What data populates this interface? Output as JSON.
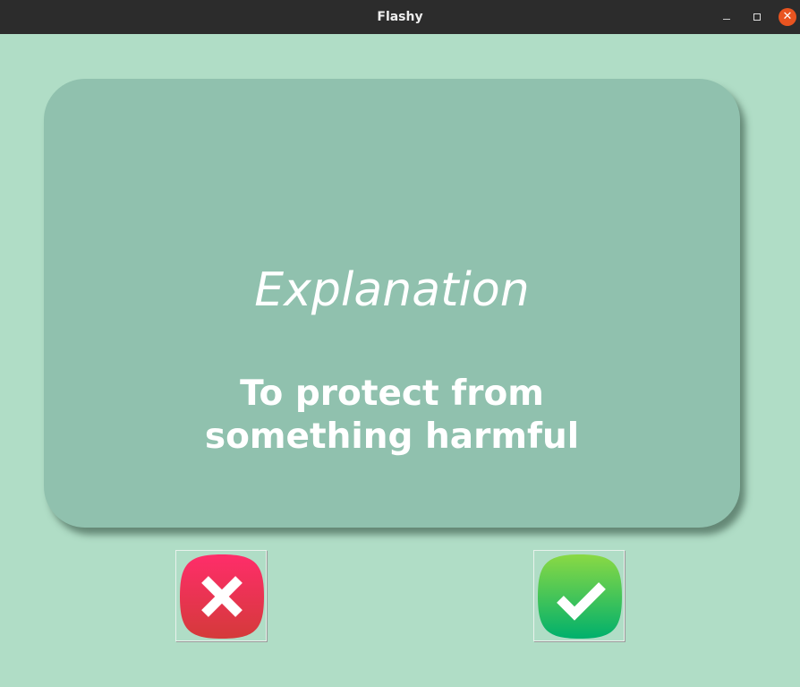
{
  "window": {
    "title": "Flashy",
    "controls": {
      "minimize": "minimize-icon",
      "maximize": "maximize-icon",
      "close": "close-icon"
    }
  },
  "card": {
    "heading": "Explanation",
    "text": "To protect from something harmful"
  },
  "actions": {
    "wrong": {
      "icon": "x-icon",
      "color": "#e8365a"
    },
    "right": {
      "icon": "check-icon",
      "color": "#27c062"
    }
  }
}
